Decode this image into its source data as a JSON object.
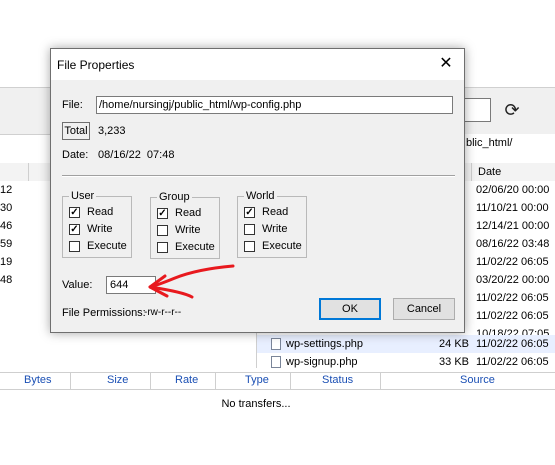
{
  "background": {
    "left_numbers": [
      "12",
      "30",
      "46",
      "59",
      "19",
      "48"
    ],
    "remote_path": "blic_html/",
    "date_header": "Date",
    "files": [
      {
        "name": "",
        "size": "",
        "date": "02/06/20 00:00"
      },
      {
        "name": "",
        "size": "",
        "date": "11/10/21 00:00"
      },
      {
        "name": "",
        "size": "",
        "date": "12/14/21 00:00"
      },
      {
        "name": "",
        "size": "",
        "date": "08/16/22 03:48"
      },
      {
        "name": "",
        "size": "",
        "date": "11/02/22 06:05"
      },
      {
        "name": "",
        "size": "",
        "date": "03/20/22 00:00"
      },
      {
        "name": "",
        "size": "",
        "date": "11/02/22 06:05"
      },
      {
        "name": "",
        "size": "",
        "date": "11/02/22 06:05"
      },
      {
        "name": "",
        "size": "",
        "date": "10/18/22 07:05"
      },
      {
        "name": "wp-settings.php",
        "size": "24 KB",
        "date": "11/02/22 06:05"
      },
      {
        "name": "wp-signup.php",
        "size": "33 KB",
        "date": "11/02/22 06:05"
      }
    ],
    "transfer_columns": [
      "Bytes",
      "Size",
      "Rate",
      "Type",
      "Status",
      "Source"
    ],
    "no_transfers": "No transfers..."
  },
  "dialog": {
    "title": "File Properties",
    "close_glyph": "✕",
    "file_label": "File:",
    "file_path": "/home/nursingj/public_html/wp-config.php",
    "total_label": "Total",
    "total_value": "3,233",
    "date_label": "Date:",
    "date_value": "08/16/22  07:48",
    "groups": [
      {
        "title": "User",
        "options": [
          {
            "label": "Read",
            "checked": true
          },
          {
            "label": "Write",
            "checked": true
          },
          {
            "label": "Execute",
            "checked": false
          }
        ]
      },
      {
        "title": "Group",
        "options": [
          {
            "label": "Read",
            "checked": true
          },
          {
            "label": "Write",
            "checked": false
          },
          {
            "label": "Execute",
            "checked": false
          }
        ]
      },
      {
        "title": "World",
        "options": [
          {
            "label": "Read",
            "checked": true
          },
          {
            "label": "Write",
            "checked": false
          },
          {
            "label": "Execute",
            "checked": false
          }
        ]
      }
    ],
    "value_label": "Value:",
    "value": "644",
    "permissions_label": "File Permissions:",
    "permissions_value": "-rw-r--r--",
    "ok_label": "OK",
    "cancel_label": "Cancel"
  },
  "annotation": {
    "color": "#e8191e"
  },
  "colors": {
    "accent": "#0078d7",
    "column_header_text": "#1a4fb4"
  }
}
